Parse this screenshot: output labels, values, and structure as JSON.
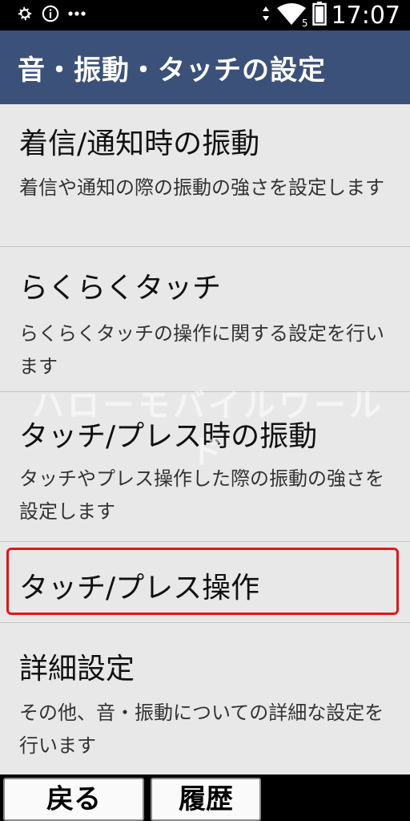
{
  "status_bar": {
    "time": "17:07",
    "left_icons": [
      "gear-icon",
      "info-icon",
      "more-icon"
    ],
    "right_icons": [
      "vibrate-icon",
      "wifi-icon",
      "battery-icon"
    ],
    "wifi_badge": "5"
  },
  "header": {
    "title": "音・振動・タッチの設定",
    "background": "#3c5179"
  },
  "items": [
    {
      "title": "着信/通知時の振動",
      "description": "着信や通知の際の振動の強さを設定します"
    },
    {
      "title": "らくらくタッチ",
      "description": "らくらくタッチの操作に関する設定を行います"
    },
    {
      "title": "タッチ/プレス時の振動",
      "description": "タッチやプレス操作した際の振動の強さを設定します"
    },
    {
      "title": "タッチ/プレス操作",
      "description": ""
    },
    {
      "title": "詳細設定",
      "description": "その他、音・振動についての詳細な設定を行います"
    }
  ],
  "focus_color": "#e01818",
  "watermark": "ハローモバイルワールド",
  "buttons": {
    "back": "戻る",
    "history": "履歴"
  }
}
